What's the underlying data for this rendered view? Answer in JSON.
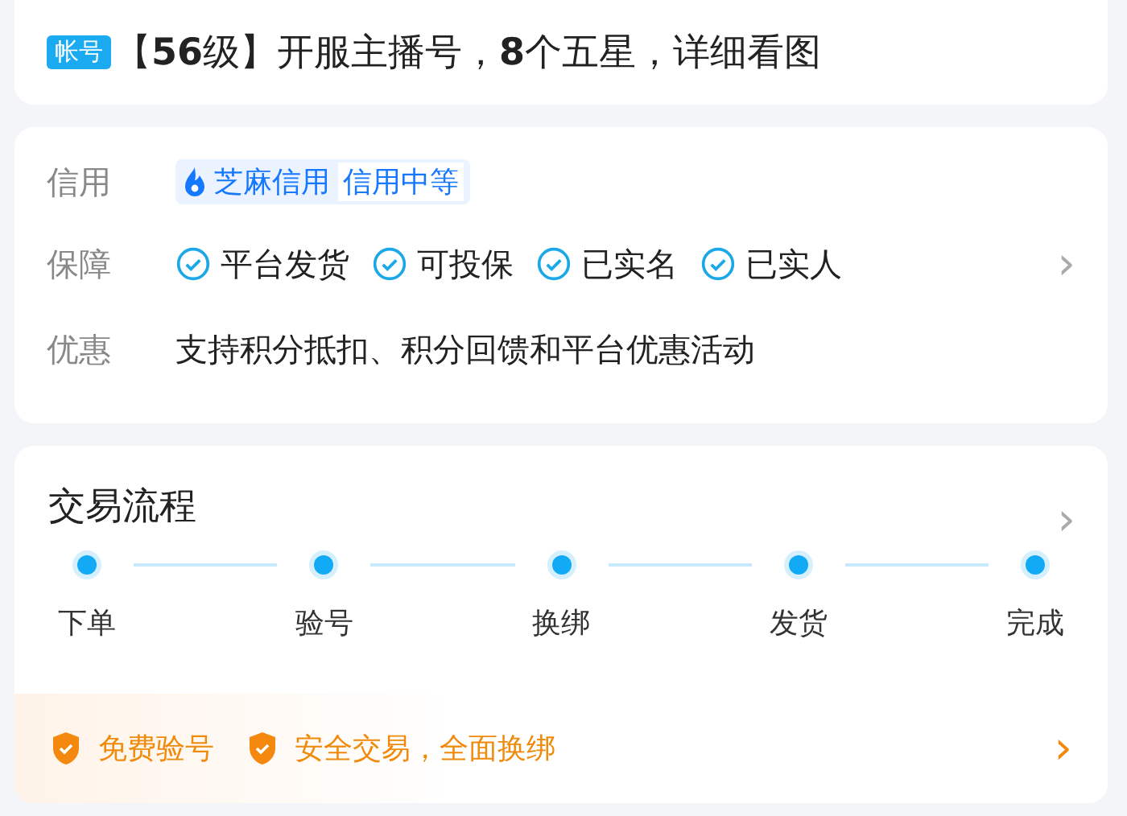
{
  "listing": {
    "badge": "帐号",
    "title": "【**56**级】开服主播号，**8**个五星，详细看图"
  },
  "info": {
    "credit": {
      "label": "信用",
      "brand": "芝麻信用",
      "level": "信用中等"
    },
    "guarantee": {
      "label": "保障",
      "items": [
        "平台发货",
        "可投保",
        "已实名",
        "已实人"
      ],
      "chevron": "›"
    },
    "discount": {
      "label": "优惠",
      "text": "支持积分抵扣、积分回馈和平台优惠活动"
    }
  },
  "process": {
    "title": "交易流程",
    "chevron": "›",
    "steps": [
      "下单",
      "验号",
      "换绑",
      "发货",
      "完成"
    ],
    "perks": [
      "免费验号",
      "安全交易，全面换绑"
    ],
    "perk_chevron": "›"
  }
}
